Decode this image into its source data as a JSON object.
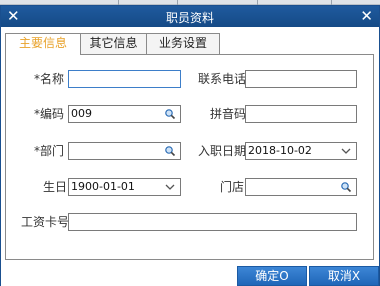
{
  "window": {
    "title": "职员资料"
  },
  "tabs": [
    {
      "label": "主要信息"
    },
    {
      "label": "其它信息"
    },
    {
      "label": "业务设置"
    }
  ],
  "form": {
    "name": {
      "required_mark": "*",
      "label": "名称",
      "value": ""
    },
    "code": {
      "required_mark": "*",
      "label": "编码",
      "value": "009"
    },
    "dept": {
      "required_mark": "*",
      "label": "部门",
      "value": ""
    },
    "birthday": {
      "label": "生日",
      "value": "1900-01-01"
    },
    "salary_card": {
      "label": "工资卡号",
      "value": ""
    },
    "phone": {
      "label": "联系电话",
      "value": ""
    },
    "pinyin": {
      "label": "拼音码",
      "value": ""
    },
    "hire_date": {
      "label": "入职日期",
      "value": "2018-10-02"
    },
    "store": {
      "label": "门店",
      "value": ""
    }
  },
  "buttons": {
    "confirm": "确定O",
    "cancel": "取消X"
  },
  "colors": {
    "titlebar": "#1f5a9e",
    "active_tab_text": "#e8a22a",
    "button": "#2f78c9",
    "focus_border": "#3d7ec9"
  },
  "icons": {
    "lookup": "magnifier-icon",
    "dropdown": "chevron-down-icon",
    "close": "close-icon"
  }
}
